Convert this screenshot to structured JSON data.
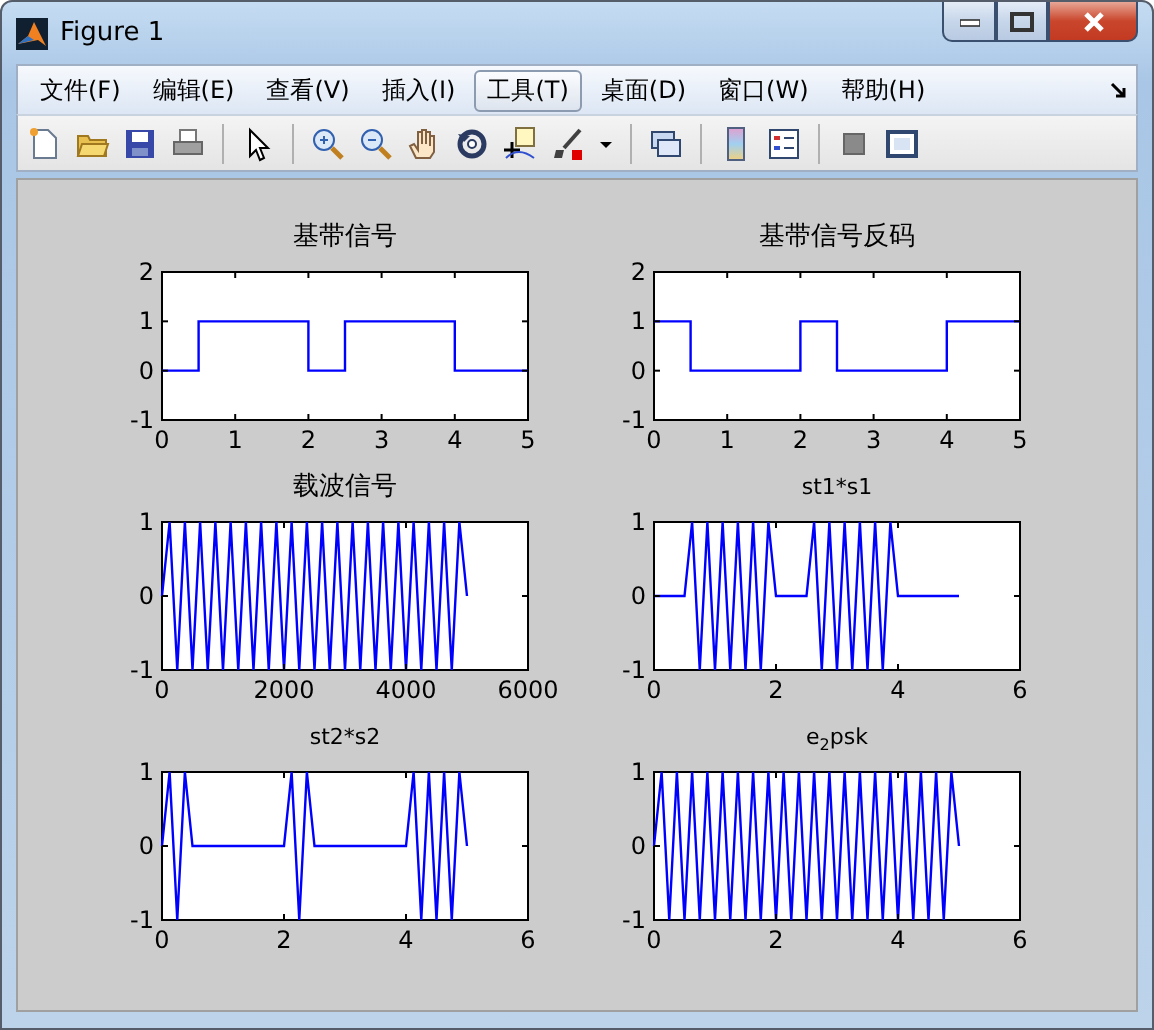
{
  "window": {
    "title": "Figure 1"
  },
  "menu": [
    {
      "label": "文件(F)",
      "selected": false
    },
    {
      "label": "编辑(E)",
      "selected": false
    },
    {
      "label": "查看(V)",
      "selected": false
    },
    {
      "label": "插入(I)",
      "selected": false
    },
    {
      "label": "工具(T)",
      "selected": true
    },
    {
      "label": "桌面(D)",
      "selected": false
    },
    {
      "label": "窗口(W)",
      "selected": false
    },
    {
      "label": "帮助(H)",
      "selected": false
    }
  ],
  "figure": {
    "plots": [
      {
        "chart_data": {
          "type": "line",
          "title": "基带信号",
          "x": [
            0,
            0.5,
            0.5,
            2,
            2,
            2.5,
            2.5,
            4,
            4,
            5
          ],
          "series": [
            {
              "color": "#0000ff",
              "values": [
                0,
                0,
                1,
                1,
                0,
                0,
                1,
                1,
                0,
                0
              ]
            }
          ],
          "xlim": [
            0,
            5
          ],
          "ylim": [
            -1,
            2
          ],
          "xticks": [
            0,
            1,
            2,
            3,
            4,
            5
          ],
          "yticks": [
            -1,
            0,
            1,
            2
          ]
        }
      },
      {
        "chart_data": {
          "type": "line",
          "title": "基带信号反码",
          "x": [
            0,
            0.5,
            0.5,
            2,
            2,
            2.5,
            2.5,
            4,
            4,
            5
          ],
          "series": [
            {
              "color": "#0000ff",
              "values": [
                1,
                1,
                0,
                0,
                1,
                1,
                0,
                0,
                1,
                1
              ]
            }
          ],
          "xlim": [
            0,
            5
          ],
          "ylim": [
            -1,
            2
          ],
          "xticks": [
            0,
            1,
            2,
            3,
            4,
            5
          ],
          "yticks": [
            -1,
            0,
            1,
            2
          ]
        }
      },
      {
        "chart_data": {
          "type": "line",
          "title": "载波信号",
          "x": [
            0,
            125,
            250,
            375,
            500,
            625,
            750,
            875,
            1000,
            1125,
            1250,
            1375,
            1500,
            1625,
            1750,
            1875,
            2000,
            2125,
            2250,
            2375,
            2500,
            2625,
            2750,
            2875,
            3000,
            3125,
            3250,
            3375,
            3500,
            3625,
            3750,
            3875,
            4000,
            4125,
            4250,
            4375,
            4500,
            4625,
            4750,
            4875,
            5000
          ],
          "series": [
            {
              "color": "#0000ff",
              "values": [
                0,
                1,
                -1,
                1,
                -1,
                1,
                -1,
                1,
                -1,
                1,
                -1,
                1,
                -1,
                1,
                -1,
                1,
                -1,
                1,
                -1,
                1,
                -1,
                1,
                -1,
                1,
                -1,
                1,
                -1,
                1,
                -1,
                1,
                -1,
                1,
                -1,
                1,
                -1,
                1,
                -1,
                1,
                -1,
                1,
                0
              ]
            }
          ],
          "xlim": [
            0,
            6000
          ],
          "ylim": [
            -1,
            1
          ],
          "xticks": [
            0,
            2000,
            4000,
            6000
          ],
          "yticks": [
            -1,
            0,
            1
          ]
        }
      },
      {
        "chart_data": {
          "type": "line",
          "title": "st1*s1",
          "x": [
            0,
            0.125,
            0.25,
            0.375,
            0.5,
            0.625,
            0.75,
            0.875,
            1,
            1.125,
            1.25,
            1.375,
            1.5,
            1.625,
            1.75,
            1.875,
            2,
            2.125,
            2.25,
            2.375,
            2.5,
            2.625,
            2.75,
            2.875,
            3,
            3.125,
            3.25,
            3.375,
            3.5,
            3.625,
            3.75,
            3.875,
            4,
            4.125,
            4.25,
            4.375,
            4.5,
            4.625,
            4.75,
            4.875,
            5
          ],
          "series": [
            {
              "color": "#0000ff",
              "values": [
                0,
                0,
                0,
                0,
                0,
                1,
                -1,
                1,
                -1,
                1,
                -1,
                1,
                -1,
                1,
                -1,
                1,
                0,
                0,
                0,
                0,
                0,
                1,
                -1,
                1,
                -1,
                1,
                -1,
                1,
                -1,
                1,
                -1,
                1,
                0,
                0,
                0,
                0,
                0,
                0,
                0,
                0,
                0
              ]
            }
          ],
          "xlim": [
            0,
            6
          ],
          "ylim": [
            -1,
            1
          ],
          "xticks": [
            0,
            2,
            4,
            6
          ],
          "yticks": [
            -1,
            0,
            1
          ]
        }
      },
      {
        "chart_data": {
          "type": "line",
          "title": "st2*s2",
          "x": [
            0,
            0.125,
            0.25,
            0.375,
            0.5,
            0.625,
            0.75,
            0.875,
            1,
            1.125,
            1.25,
            1.375,
            1.5,
            1.625,
            1.75,
            1.875,
            2,
            2.125,
            2.25,
            2.375,
            2.5,
            2.625,
            2.75,
            2.875,
            3,
            3.125,
            3.25,
            3.375,
            3.5,
            3.625,
            3.75,
            3.875,
            4,
            4.125,
            4.25,
            4.375,
            4.5,
            4.625,
            4.75,
            4.875,
            5
          ],
          "series": [
            {
              "color": "#0000ff",
              "values": [
                0,
                1,
                -1,
                1,
                0,
                0,
                0,
                0,
                0,
                0,
                0,
                0,
                0,
                0,
                0,
                0,
                0,
                1,
                -1,
                1,
                0,
                0,
                0,
                0,
                0,
                0,
                0,
                0,
                0,
                0,
                0,
                0,
                0,
                1,
                -1,
                1,
                -1,
                1,
                -1,
                1,
                0
              ]
            }
          ],
          "xlim": [
            0,
            6
          ],
          "ylim": [
            -1,
            1
          ],
          "xticks": [
            0,
            2,
            4,
            6
          ],
          "yticks": [
            -1,
            0,
            1
          ]
        }
      },
      {
        "chart_data": {
          "type": "line",
          "title": "e$_{2}$psk",
          "x": [
            0,
            0.125,
            0.25,
            0.375,
            0.5,
            0.625,
            0.75,
            0.875,
            1,
            1.125,
            1.25,
            1.375,
            1.5,
            1.625,
            1.75,
            1.875,
            2,
            2.125,
            2.25,
            2.375,
            2.5,
            2.625,
            2.75,
            2.875,
            3,
            3.125,
            3.25,
            3.375,
            3.5,
            3.625,
            3.75,
            3.875,
            4,
            4.125,
            4.25,
            4.375,
            4.5,
            4.625,
            4.75,
            4.875,
            5
          ],
          "series": [
            {
              "color": "#0000ff",
              "values": [
                0,
                1,
                -1,
                1,
                -1,
                1,
                -1,
                1,
                -1,
                1,
                -1,
                1,
                -1,
                1,
                -1,
                1,
                -1,
                1,
                -1,
                1,
                -1,
                1,
                -1,
                1,
                -1,
                1,
                -1,
                1,
                -1,
                1,
                -1,
                1,
                -1,
                1,
                -1,
                1,
                -1,
                1,
                -1,
                1,
                0
              ]
            }
          ],
          "xlim": [
            0,
            6
          ],
          "ylim": [
            -1,
            1
          ],
          "xticks": [
            0,
            2,
            4,
            6
          ],
          "yticks": [
            -1,
            0,
            1
          ]
        }
      }
    ]
  }
}
